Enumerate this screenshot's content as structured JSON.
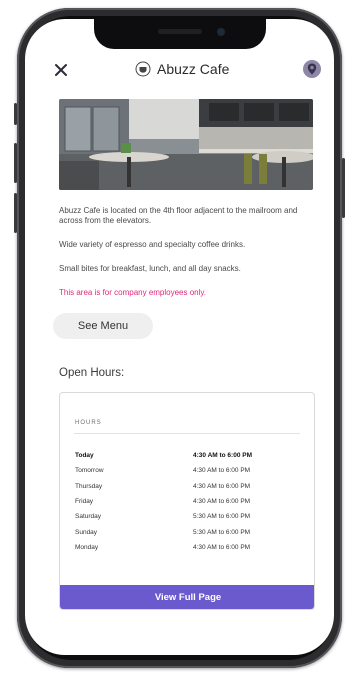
{
  "header": {
    "title": "Abuzz Cafe",
    "close_icon": "close-icon",
    "logo_icon": "coffee-cup-icon",
    "location_icon": "location-pin-icon"
  },
  "description": {
    "line1": "Abuzz Cafe is located on the 4th floor adjacent to the mailroom and across from the elevators.",
    "line2": "Wide variety of espresso and specialty coffee drinks.",
    "line3": "Small bites for breakfast, lunch, and all day snacks.",
    "notice": "This area is for company employees only."
  },
  "see_menu_label": "See Menu",
  "open_hours_heading": "Open Hours:",
  "hours": {
    "label": "HOURS",
    "rows": [
      {
        "day": "Today",
        "time": "4:30 AM to 6:00 PM"
      },
      {
        "day": "Tomorrow",
        "time": "4:30 AM to 6:00 PM"
      },
      {
        "day": "Thursday",
        "time": "4:30 AM to 6:00 PM"
      },
      {
        "day": "Friday",
        "time": "4:30 AM to 6:00 PM"
      },
      {
        "day": "Saturday",
        "time": "5:30 AM to 6:00 PM"
      },
      {
        "day": "Sunday",
        "time": "5:30 AM to 6:00 PM"
      },
      {
        "day": "Monday",
        "time": "4:30 AM to 6:00 PM"
      }
    ]
  },
  "view_full_page_label": "View Full Page",
  "colors": {
    "accent": "#6a5acd",
    "notice": "#e0287a",
    "pin": "#8e87a6"
  }
}
